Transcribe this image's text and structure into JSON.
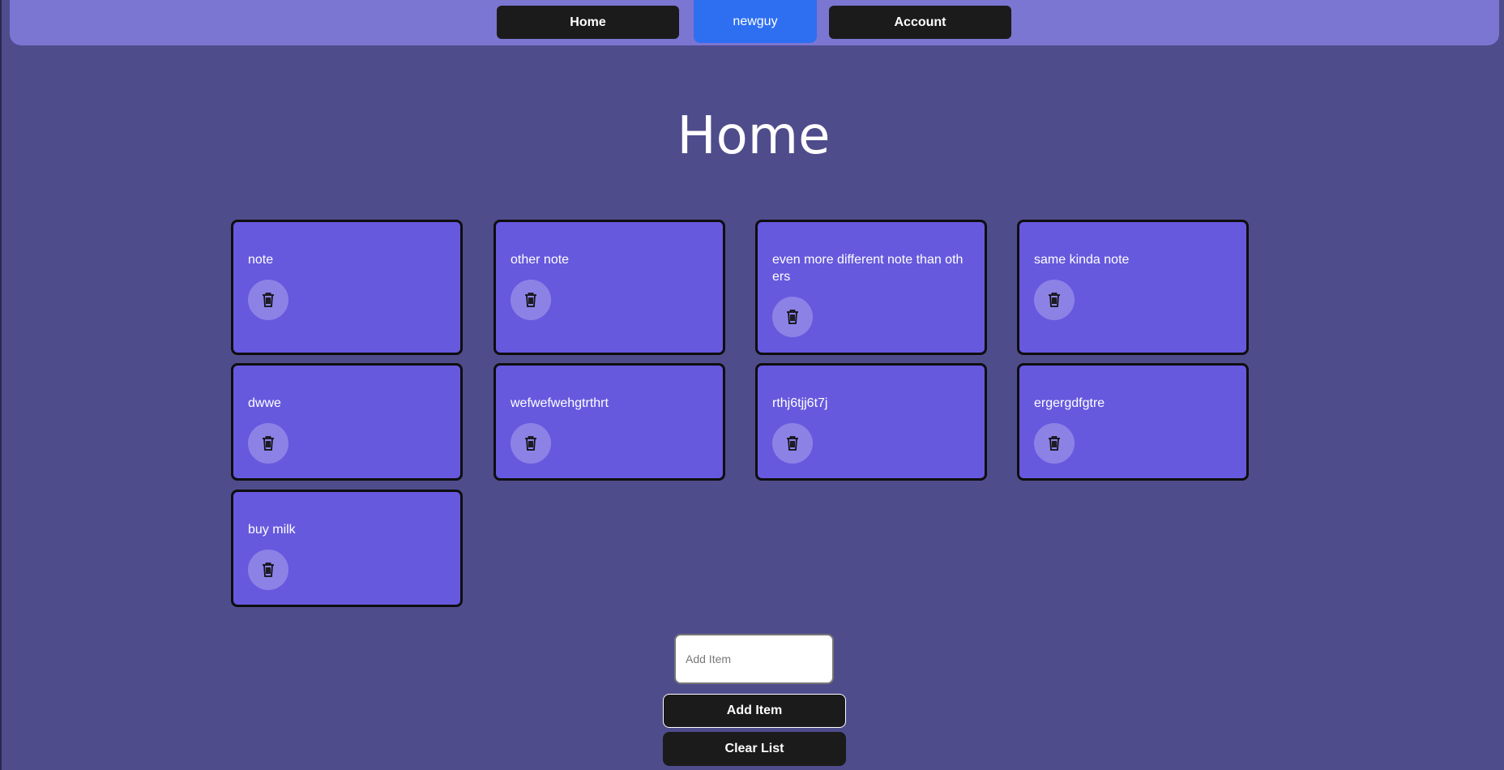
{
  "nav": {
    "home_label": "Home",
    "user_label": "newguy",
    "account_label": "Account"
  },
  "page": {
    "title": "Home"
  },
  "notes": [
    {
      "text": "note"
    },
    {
      "text": "other note"
    },
    {
      "text": "even more different note than others"
    },
    {
      "text": "same kinda note"
    },
    {
      "text": "dwwe"
    },
    {
      "text": "wefwefwehgtrthrt"
    },
    {
      "text": "rthj6tjj6t7j"
    },
    {
      "text": "ergergdfgtre"
    },
    {
      "text": "buy milk"
    }
  ],
  "form": {
    "input_placeholder": "Add Item",
    "input_value": "",
    "add_label": "Add Item",
    "clear_label": "Clear List"
  },
  "icons": {
    "delete": "trash-icon"
  },
  "colors": {
    "background": "#4f4c8c",
    "navbar": "#7b76d2",
    "card": "#6659de",
    "user_button": "#2e6ff2",
    "button_dark": "#1b1b1b"
  }
}
